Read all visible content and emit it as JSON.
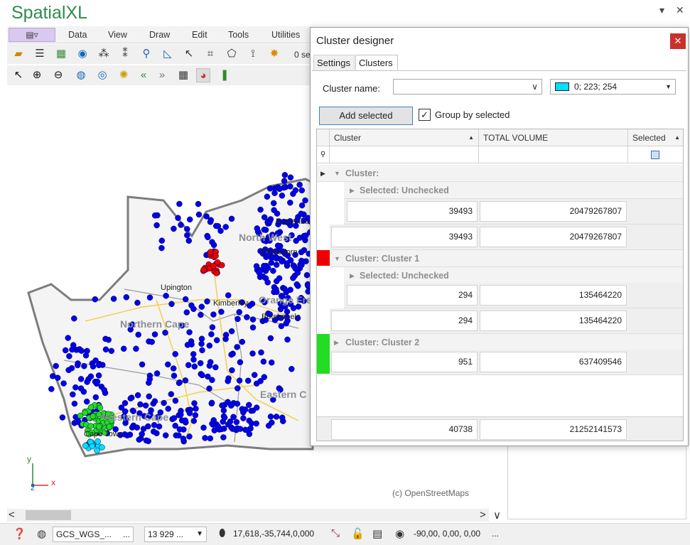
{
  "app": {
    "title": "SpatialXL"
  },
  "menu": {
    "items": [
      "Data",
      "View",
      "Draw",
      "Edit",
      "Tools",
      "Utilities"
    ]
  },
  "toolbar": {
    "truncated_text": "0 se"
  },
  "map": {
    "labels": [
      "Upington",
      "Kimberley",
      "Klerksdorp",
      "Botshabelo",
      "Cape Town",
      "Rustenburg"
    ],
    "regions": [
      "Northern Cape",
      "Western Cape",
      "North West",
      "Orange Free",
      "Eastern C"
    ],
    "copyright": "(c) OpenStreetMaps",
    "axis": {
      "y": "y",
      "z": "z",
      "x": "x"
    },
    "colors": {
      "base_points": "#0000ee",
      "cluster1": "#ee0000",
      "cluster2": "#22dd22",
      "cluster_selected": "#00dffe"
    }
  },
  "statusbar": {
    "crs": "GCS_WGS_...",
    "scale": "13 929 ...",
    "coords": "17,618,-35,744,0,000",
    "view_angles": "-90,00, 0,00, 0,00",
    "ellipsis": "..."
  },
  "dialog": {
    "title": "Cluster designer",
    "tabs": [
      "Settings",
      "Clusters"
    ],
    "cluster_name_label": "Cluster name:",
    "cluster_name_value": "",
    "color_value": "0; 223; 254",
    "add_button": "Add selected",
    "group_by_label": "Group by selected",
    "group_by_checked": true,
    "columns": [
      "Cluster",
      "TOTAL VOLUME",
      "Selected"
    ],
    "groups": [
      {
        "label": "Cluster:",
        "color": "",
        "sub": "Selected: Unchecked",
        "sub_count": "39493",
        "sub_volume": "20479267807",
        "count": "39493",
        "volume": "20479267807"
      },
      {
        "label": "Cluster: Cluster 1",
        "color": "#ee0000",
        "sub": "Selected: Unchecked",
        "sub_count": "294",
        "sub_volume": "135464220",
        "count": "294",
        "volume": "135464220"
      },
      {
        "label": "Cluster: Cluster 2",
        "color": "#22dd22",
        "count": "951",
        "volume": "637409546"
      }
    ],
    "total": {
      "count": "40738",
      "volume": "21252141573"
    }
  }
}
